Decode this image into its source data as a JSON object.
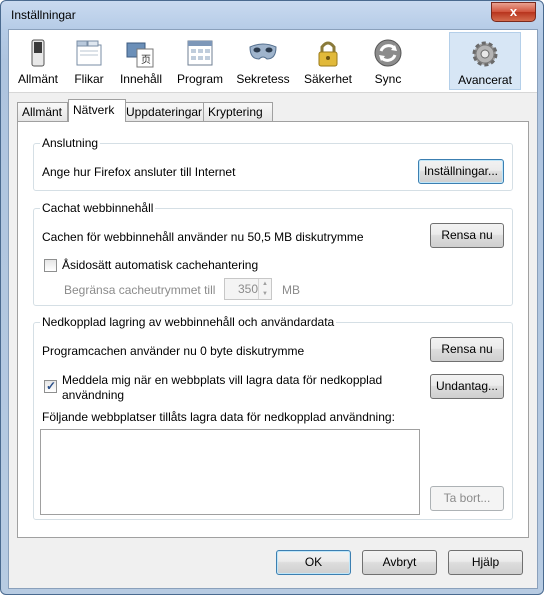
{
  "window": {
    "title": "Inställningar",
    "close_symbol": "x"
  },
  "toolbar": {
    "items": [
      {
        "label": "Allmänt",
        "icon": "switch-icon"
      },
      {
        "label": "Flikar",
        "icon": "tabs-icon"
      },
      {
        "label": "Innehåll",
        "icon": "content-icon"
      },
      {
        "label": "Program",
        "icon": "applications-icon"
      },
      {
        "label": "Sekretess",
        "icon": "privacy-mask-icon"
      },
      {
        "label": "Säkerhet",
        "icon": "padlock-icon"
      },
      {
        "label": "Sync",
        "icon": "sync-icon"
      },
      {
        "label": "Avancerat",
        "icon": "gear-icon",
        "selected": true
      }
    ]
  },
  "tabs": [
    "Allmänt",
    "Nätverk",
    "Uppdateringar",
    "Kryptering"
  ],
  "active_tab": "Nätverk",
  "connection": {
    "legend": "Anslutning",
    "text": "Ange hur Firefox ansluter till Internet",
    "button": "Inställningar..."
  },
  "cache": {
    "legend": "Cachat webbinnehåll",
    "text": "Cachen för webbinnehåll använder nu 50,5 MB diskutrymme",
    "clear_button": "Rensa nu",
    "override_label": "Åsidosätt automatisk cachehantering",
    "override_checked": false,
    "limit_label": "Begränsa cacheutrymmet till",
    "limit_value": "350",
    "limit_unit": "MB"
  },
  "offline": {
    "legend": "Nedkopplad lagring av webbinnehåll och användardata",
    "text": "Programcachen använder nu 0 byte diskutrymme",
    "clear_button": "Rensa nu",
    "notify_label_line1": "Meddela mig när en webbplats vill lagra data för nedkopplad",
    "notify_label_line2": "användning",
    "notify_checked": true,
    "exceptions_button": "Undantag...",
    "list_label": "Följande webbplatser tillåts lagra data för nedkopplad användning:",
    "remove_button": "Ta bort..."
  },
  "footer": {
    "ok": "OK",
    "cancel": "Avbryt",
    "help": "Hjälp"
  }
}
